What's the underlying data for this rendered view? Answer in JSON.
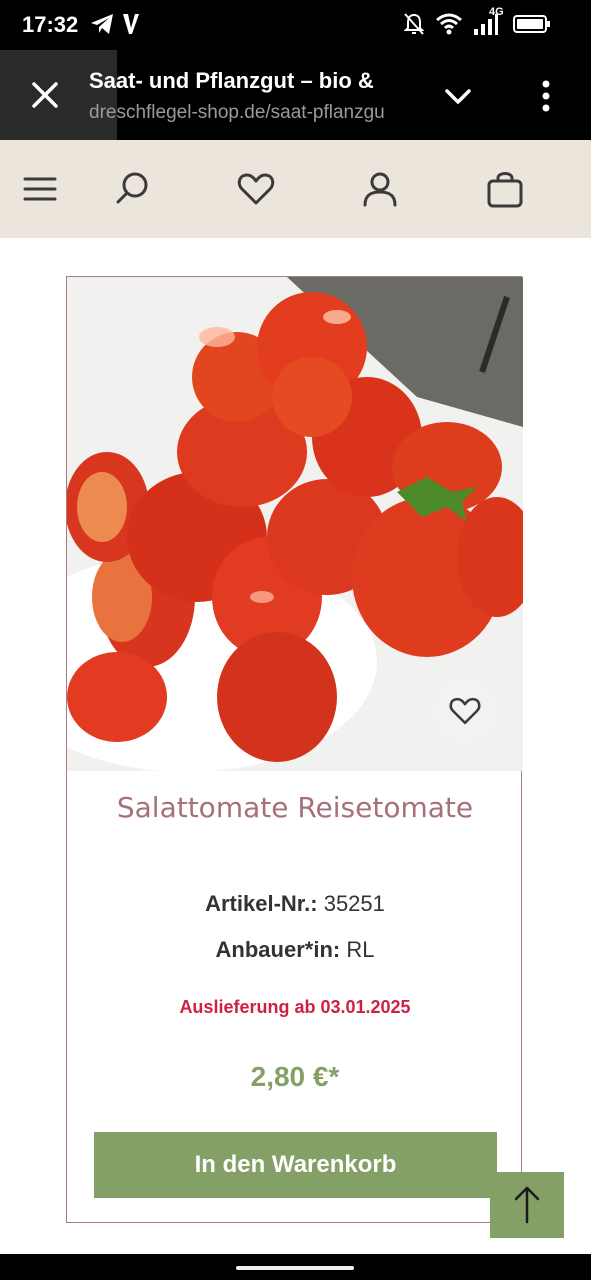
{
  "status_bar": {
    "time": "17:32",
    "left_icons": [
      "telegram-icon",
      "v-app-icon"
    ],
    "right_icons": [
      "bell-off-icon",
      "wifi-icon",
      "signal-icon",
      "battery-icon"
    ],
    "network": "4G"
  },
  "browser": {
    "title": "Saat- und Pflanzgut – bio &",
    "url": "dreschflegel-shop.de/saat-pflanzgu"
  },
  "site_header": {
    "icons": [
      "menu-icon",
      "search-icon",
      "heart-icon",
      "user-icon",
      "shopping-bag-icon"
    ]
  },
  "product": {
    "title": "Salattomate Reisetomate",
    "article_label": "Artikel-Nr.:",
    "article_value": "35251",
    "grower_label": "Anbauer*in:",
    "grower_value": "RL",
    "delivery": "Auslieferung ab 03.01.2025",
    "price": "2,80 €*",
    "cart_button": "In den Warenkorb"
  },
  "colors": {
    "header_bg": "#ece5dc",
    "accent_green": "#84a066",
    "title_rose": "#a6717b",
    "delivery_red": "#cf1f45",
    "card_border": "#a87c81"
  }
}
